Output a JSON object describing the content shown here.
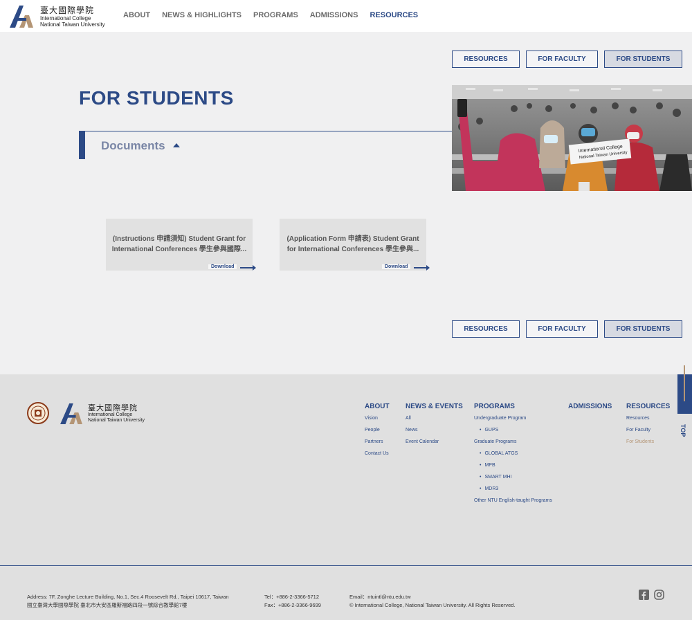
{
  "header": {
    "logo_cn": "臺大國際學院",
    "logo_en_line1": "International College",
    "logo_en_line2": "National Taiwan University",
    "nav": [
      "ABOUT",
      "NEWS & HIGHLIGHTS",
      "PROGRAMS",
      "ADMISSIONS",
      "RESOURCES"
    ],
    "nav_active": "RESOURCES"
  },
  "tabs": {
    "resources": "RESOURCES",
    "faculty": "FOR FACULTY",
    "students": "FOR STUDENTS",
    "active": "FOR STUDENTS"
  },
  "main": {
    "title": "FOR STUDENTS",
    "section": "Documents",
    "photo_sign_line1": "International College",
    "photo_sign_line2": "National Taiwan University",
    "cards": [
      {
        "line1": "(Instructions 申請須知) Student Grant for",
        "line2": "International Conferences 學生參與國際...",
        "download": "Download"
      },
      {
        "line1": "(Application Form 申請表) Student Grant",
        "line2": "for International Conferences 學生參與...",
        "download": "Download"
      }
    ]
  },
  "footer": {
    "logo_cn": "臺大國際學院",
    "logo_en_line1": "International College",
    "logo_en_line2": "National Taiwan University",
    "columns": {
      "about": {
        "head": "ABOUT",
        "links": [
          "Vision",
          "People",
          "Partners",
          "Contact Us"
        ]
      },
      "news": {
        "head": "NEWS & EVENTS",
        "links": [
          "All",
          "News",
          "Event Calendar"
        ]
      },
      "programs": {
        "head": "PROGRAMS",
        "undergrad": "Undergraduate Program",
        "gups": "GUPS",
        "grad": "Graduate Programs",
        "global_atgs": "GLOBAL ATGS",
        "mpb": "MPB",
        "smart_mhi": "SMART MHI",
        "mdr3": "MDR3",
        "other": "Other NTU English-taught Programs"
      },
      "admissions": {
        "head": "ADMISSIONS"
      },
      "resources": {
        "head": "RESOURCES",
        "links": [
          "Resources",
          "For Faculty",
          "For Students"
        ]
      }
    },
    "top_label": "TOP",
    "address_en": "Address: 7F, Zonghe Lecture Building, No.1, Sec.4 Roosevelt Rd., Taipei 10617, Taiwan",
    "address_cn": "國立臺灣大學國際學院 臺北市大安區羅斯福路四段一號綜合教學館7樓",
    "tel": "Tel：+886-2-3366-5712",
    "fax": "Fax：+886-2-3366-9699",
    "email": "Email：ntuintl@ntu.edu.tw",
    "copyright": "© International College, National Taiwan University. All Rights Reserved."
  },
  "colors": {
    "primary": "#2c4a86",
    "accent": "#b49575",
    "page_bg": "#f0f0f1",
    "footer_bg": "#e0e0e0"
  },
  "icons": [
    "logo-mark",
    "caret-up-icon",
    "arrow-right-icon",
    "seal-icon",
    "facebook-icon",
    "instagram-icon",
    "arrow-up-icon"
  ]
}
